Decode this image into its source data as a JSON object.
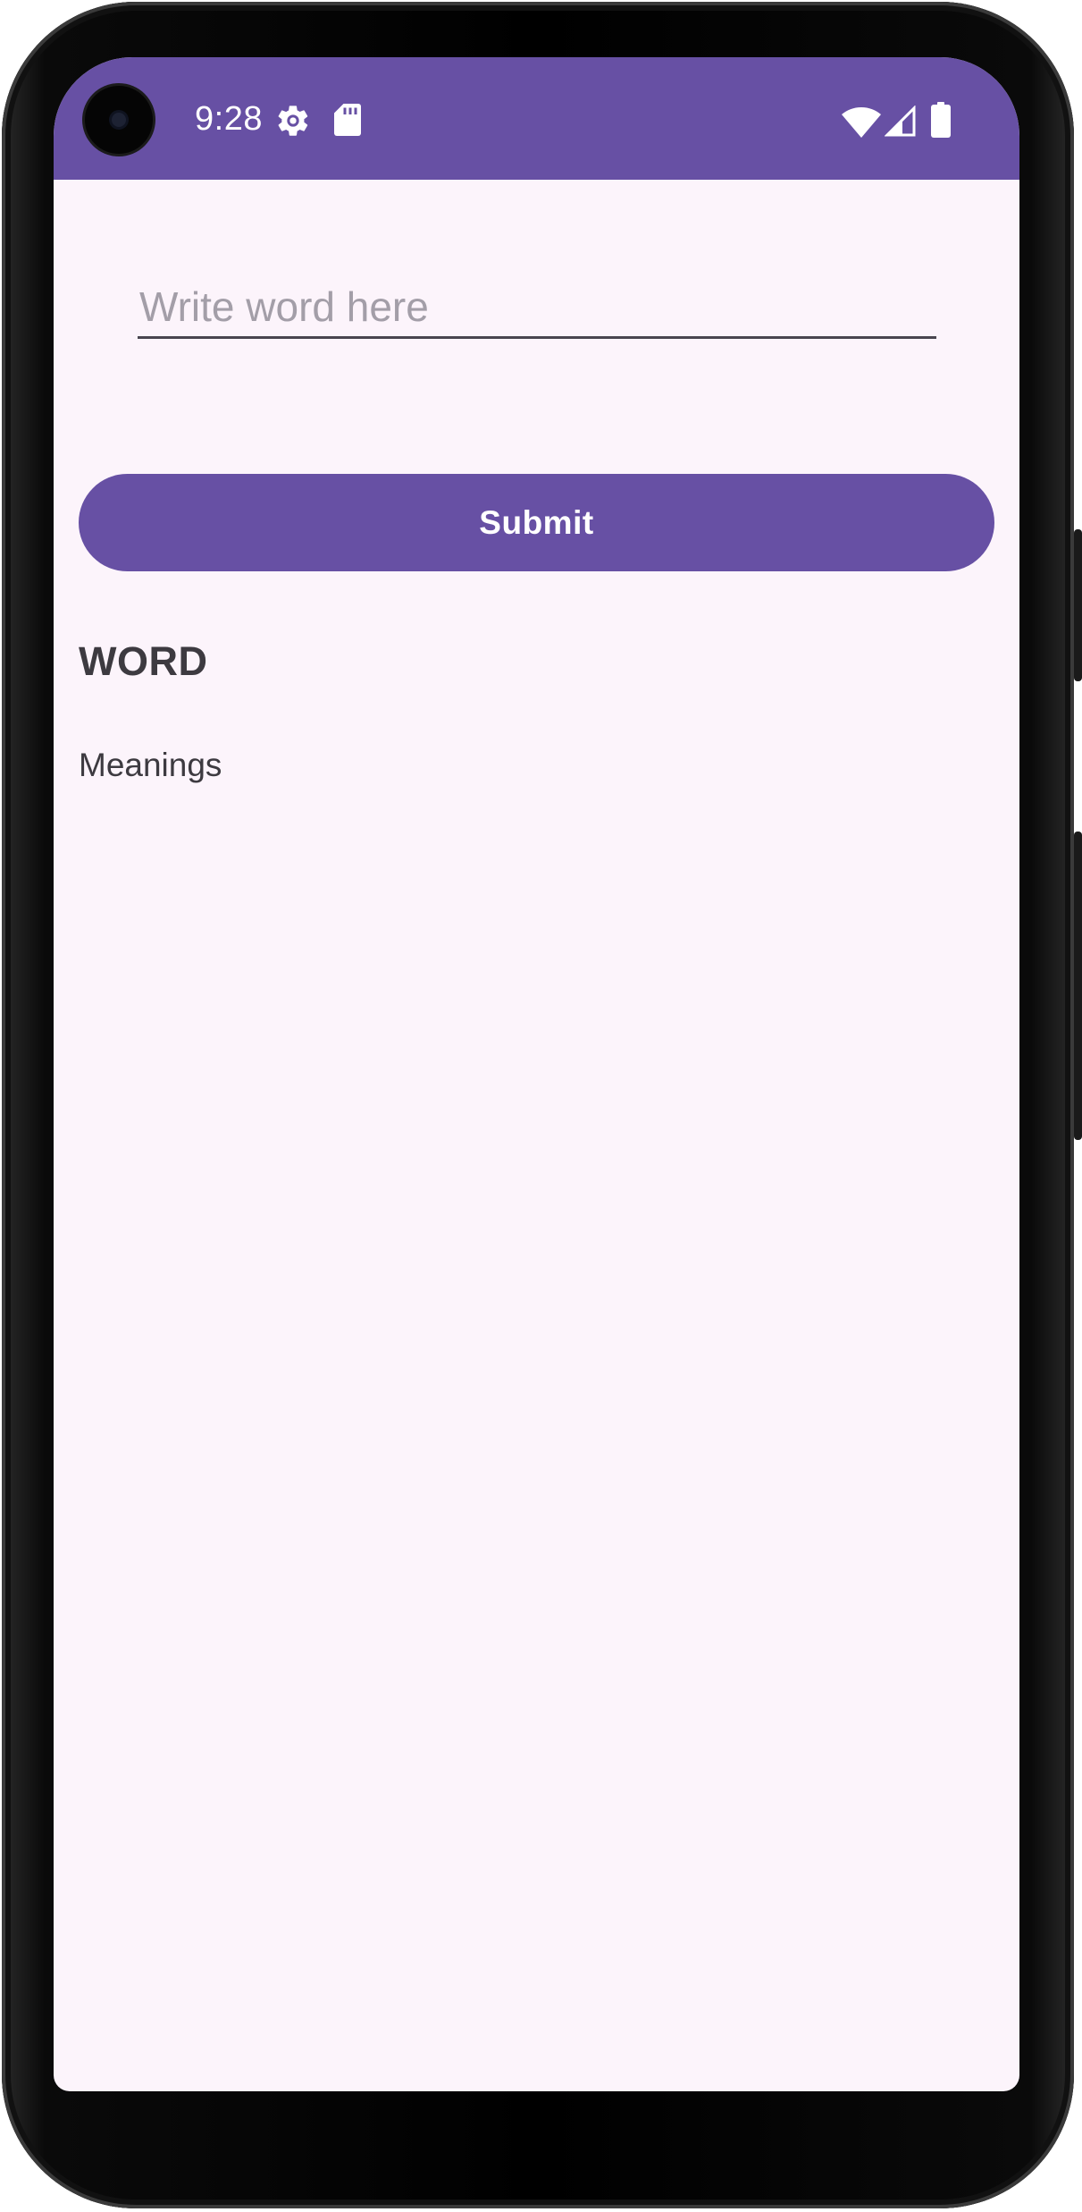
{
  "status_bar": {
    "time": "9:28",
    "background_color": "#6750a4",
    "icons": [
      "gear-icon",
      "sd-card-icon",
      "wifi-icon",
      "signal-icon",
      "battery-icon"
    ]
  },
  "search": {
    "placeholder": "Write word here",
    "value": ""
  },
  "submit": {
    "label": "Submit",
    "color": "#6750a4"
  },
  "result": {
    "word": "WORD",
    "meanings": "Meanings"
  },
  "theme": {
    "background": "#fcf4fb",
    "text": "#3d3a40"
  }
}
